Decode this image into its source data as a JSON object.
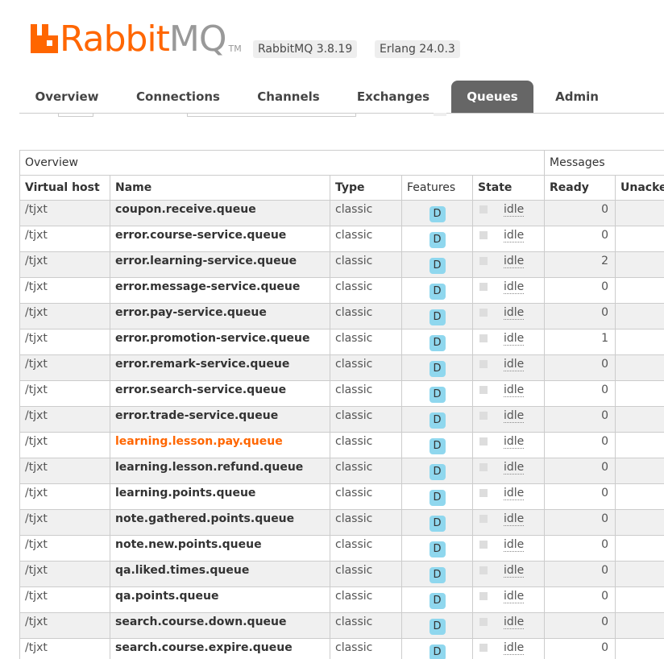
{
  "header": {
    "logo_rabbit": "Rabbit",
    "logo_mq": "MQ",
    "logo_tm": "TM",
    "version_badge": "RabbitMQ 3.8.19",
    "erlang_badge": "Erlang 24.0.3"
  },
  "tabs": [
    "Overview",
    "Connections",
    "Channels",
    "Exchanges",
    "Queues",
    "Admin"
  ],
  "active_tab": "Queues",
  "table": {
    "group_headers": {
      "overview": "Overview",
      "messages": "Messages"
    },
    "columns": [
      "Virtual host",
      "Name",
      "Type",
      "Features",
      "State",
      "Ready",
      "Unacked"
    ],
    "rows": [
      {
        "vhost": "/tjxt",
        "name": "coupon.receive.queue",
        "type": "classic",
        "feature": "D",
        "state": "idle",
        "ready": "0"
      },
      {
        "vhost": "/tjxt",
        "name": "error.course-service.queue",
        "type": "classic",
        "feature": "D",
        "state": "idle",
        "ready": "0"
      },
      {
        "vhost": "/tjxt",
        "name": "error.learning-service.queue",
        "type": "classic",
        "feature": "D",
        "state": "idle",
        "ready": "2"
      },
      {
        "vhost": "/tjxt",
        "name": "error.message-service.queue",
        "type": "classic",
        "feature": "D",
        "state": "idle",
        "ready": "0"
      },
      {
        "vhost": "/tjxt",
        "name": "error.pay-service.queue",
        "type": "classic",
        "feature": "D",
        "state": "idle",
        "ready": "0"
      },
      {
        "vhost": "/tjxt",
        "name": "error.promotion-service.queue",
        "type": "classic",
        "feature": "D",
        "state": "idle",
        "ready": "1"
      },
      {
        "vhost": "/tjxt",
        "name": "error.remark-service.queue",
        "type": "classic",
        "feature": "D",
        "state": "idle",
        "ready": "0"
      },
      {
        "vhost": "/tjxt",
        "name": "error.search-service.queue",
        "type": "classic",
        "feature": "D",
        "state": "idle",
        "ready": "0"
      },
      {
        "vhost": "/tjxt",
        "name": "error.trade-service.queue",
        "type": "classic",
        "feature": "D",
        "state": "idle",
        "ready": "0"
      },
      {
        "vhost": "/tjxt",
        "name": "learning.lesson.pay.queue",
        "type": "classic",
        "feature": "D",
        "state": "idle",
        "ready": "0",
        "highlight": true
      },
      {
        "vhost": "/tjxt",
        "name": "learning.lesson.refund.queue",
        "type": "classic",
        "feature": "D",
        "state": "idle",
        "ready": "0"
      },
      {
        "vhost": "/tjxt",
        "name": "learning.points.queue",
        "type": "classic",
        "feature": "D",
        "state": "idle",
        "ready": "0"
      },
      {
        "vhost": "/tjxt",
        "name": "note.gathered.points.queue",
        "type": "classic",
        "feature": "D",
        "state": "idle",
        "ready": "0"
      },
      {
        "vhost": "/tjxt",
        "name": "note.new.points.queue",
        "type": "classic",
        "feature": "D",
        "state": "idle",
        "ready": "0"
      },
      {
        "vhost": "/tjxt",
        "name": "qa.liked.times.queue",
        "type": "classic",
        "feature": "D",
        "state": "idle",
        "ready": "0"
      },
      {
        "vhost": "/tjxt",
        "name": "qa.points.queue",
        "type": "classic",
        "feature": "D",
        "state": "idle",
        "ready": "0"
      },
      {
        "vhost": "/tjxt",
        "name": "search.course.down.queue",
        "type": "classic",
        "feature": "D",
        "state": "idle",
        "ready": "0"
      },
      {
        "vhost": "/tjxt",
        "name": "search.course.expire.queue",
        "type": "classic",
        "feature": "D",
        "state": "idle",
        "ready": "0"
      }
    ]
  },
  "colors": {
    "brand": "#ff6600",
    "active_tab": "#666666",
    "badge": "#8fd7ee",
    "row_alt": "#f0f0f0"
  }
}
